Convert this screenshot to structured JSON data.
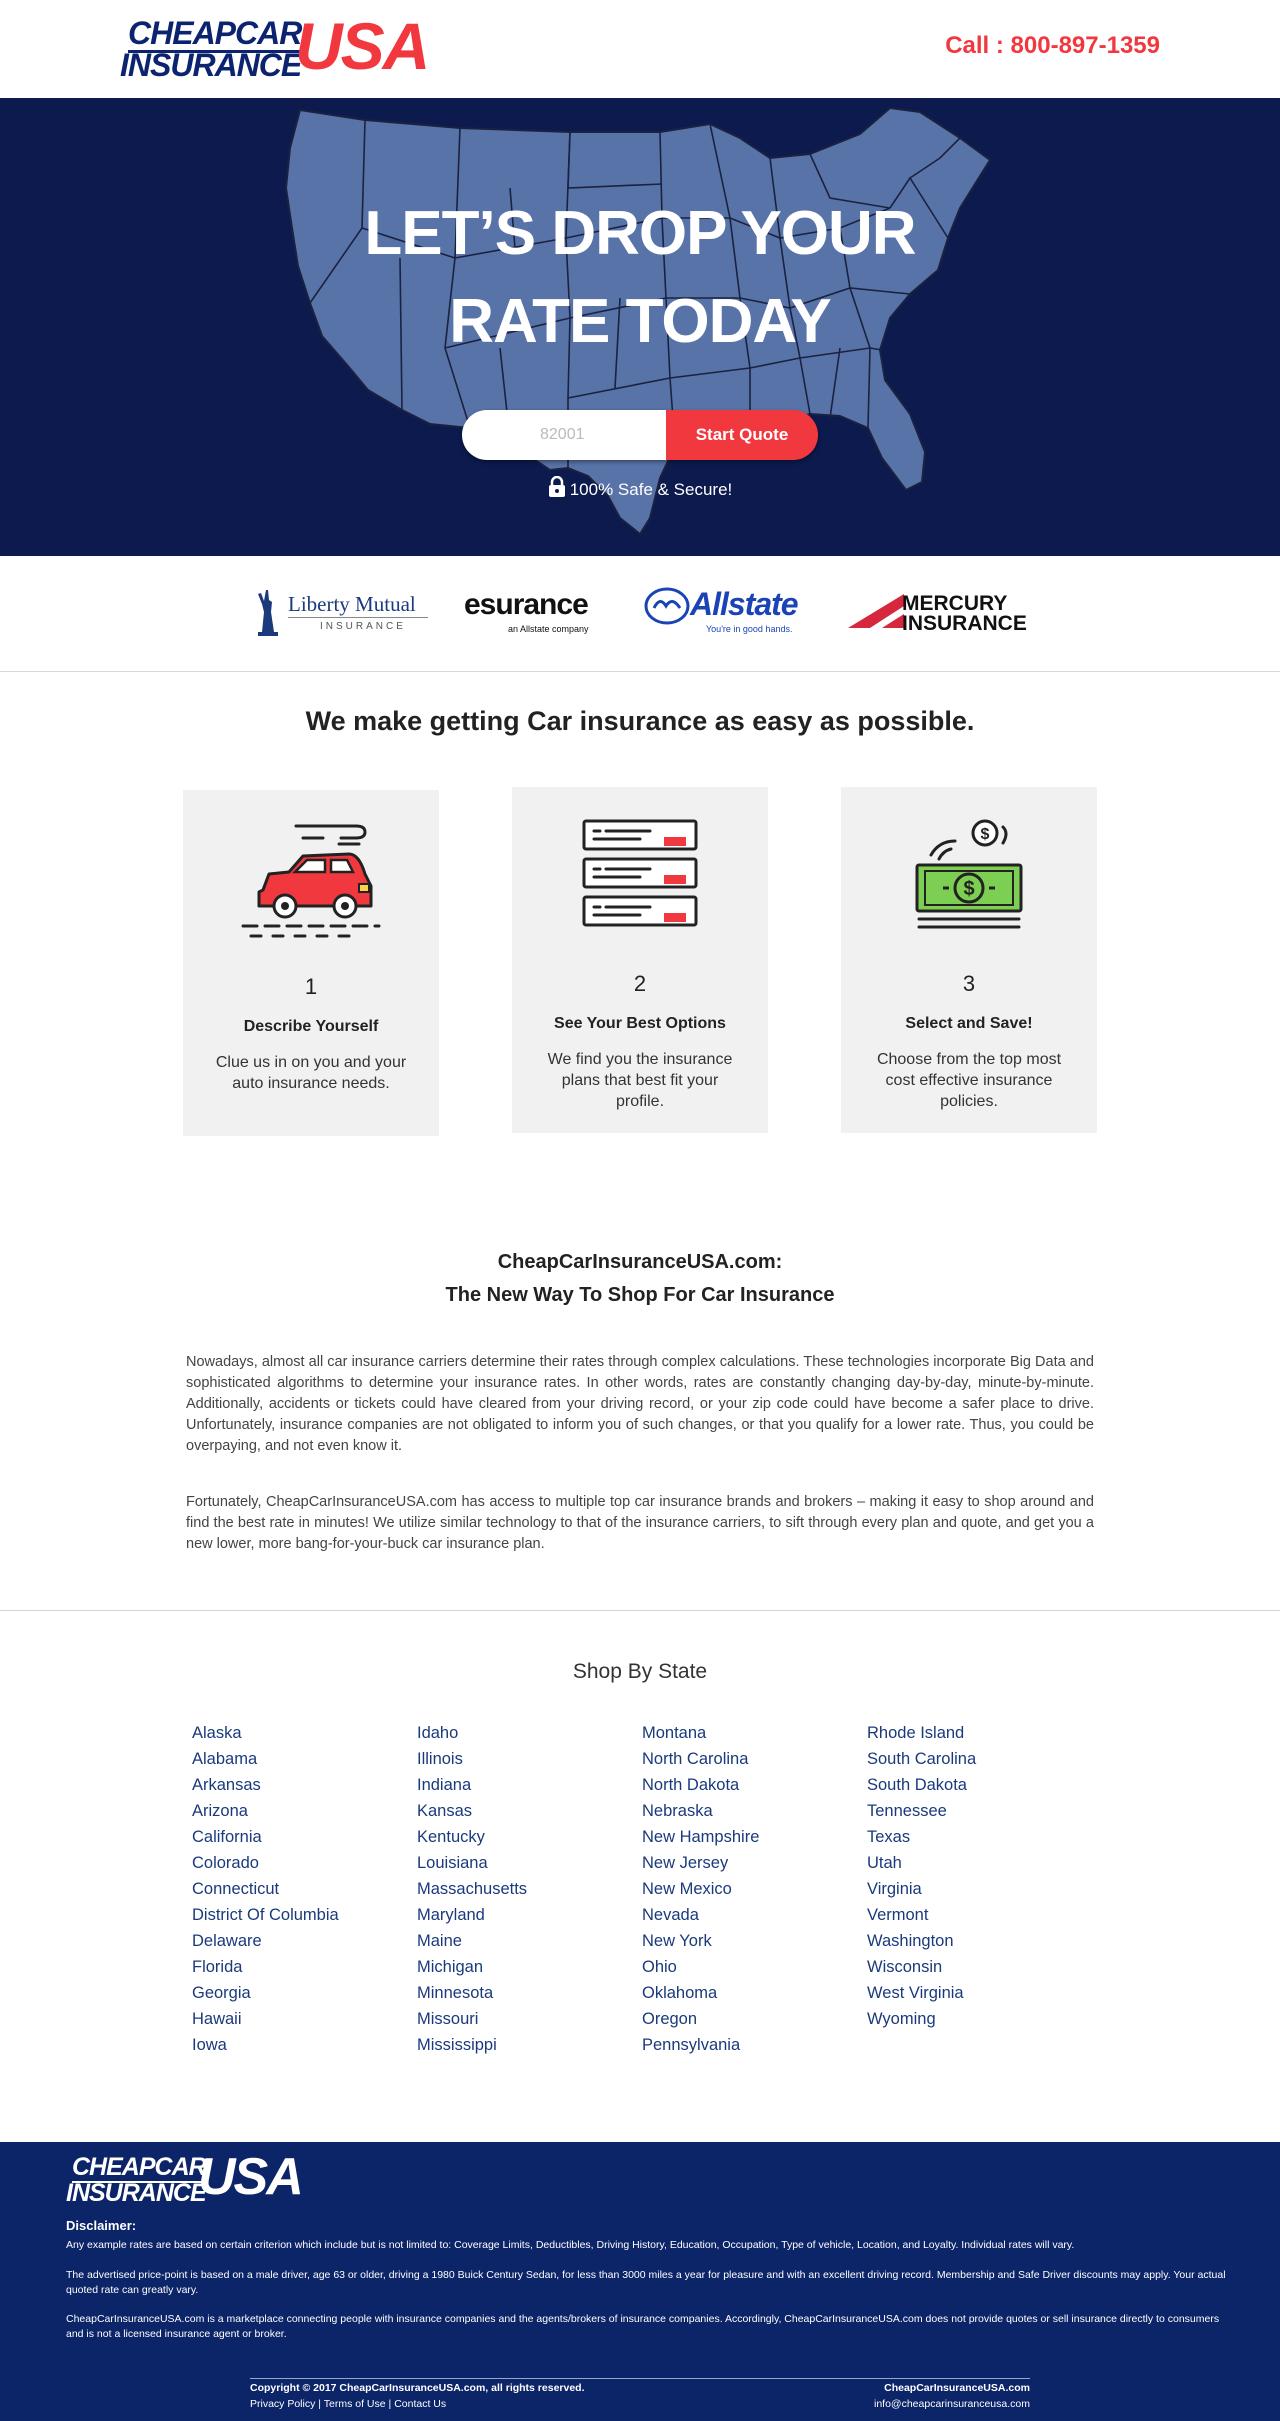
{
  "header": {
    "logo_line1": "CHEAPCAR",
    "logo_line2": "INSURANCE",
    "logo_usa": "USA",
    "phone": "Call : 800-897-1359"
  },
  "hero": {
    "title_line1": "LET’S DROP YOUR",
    "title_line2": "RATE TODAY",
    "zip_placeholder": "82001",
    "start_button": "Start Quote",
    "secure_text": "100% Safe & Secure!"
  },
  "partners": [
    {
      "name": "Liberty Mutual",
      "sub": "INSURANCE"
    },
    {
      "name": "esurance",
      "sub": "an Allstate company"
    },
    {
      "name": "Allstate",
      "sub": "You're in good hands."
    },
    {
      "name": "MERCURY",
      "sub": "INSURANCE"
    }
  ],
  "steps_section": {
    "title": "We make getting Car insurance as easy as possible.",
    "steps": [
      {
        "number": "1",
        "title": "Describe Yourself",
        "desc": "Clue us in on you and your auto insurance needs.",
        "icon": "car-icon"
      },
      {
        "number": "2",
        "title": "See Your Best Options",
        "desc": "We find you the insurance plans that best fit your profile.",
        "icon": "options-list-icon"
      },
      {
        "number": "3",
        "title": "Select and Save!",
        "desc": "Choose from the top most cost effective insurance policies.",
        "icon": "money-icon"
      }
    ]
  },
  "about": {
    "title_line1": "CheapCarInsuranceUSA.com:",
    "title_line2": "The New Way To Shop For Car Insurance",
    "p1": "Nowadays, almost all car insurance carriers determine their rates through complex calculations. These technologies incorporate Big Data and sophisticated algorithms to determine your insurance rates. In other words, rates are constantly changing day-by-day, minute-by-minute. Additionally, accidents or tickets could have cleared from your driving record, or your zip code could have become a safer place to drive. Unfortunately, insurance companies are not obligated to inform you of such changes, or that you qualify for a lower rate. Thus, you could be overpaying, and not even know it.",
    "p2": "Fortunately, CheapCarInsuranceUSA.com has access to multiple top car insurance brands and brokers – making it easy to shop around and find the best rate in minutes! We utilize similar technology to that of the insurance carriers, to sift through every plan and quote, and get you a new lower, more bang-for-your-buck car insurance plan."
  },
  "states": {
    "title": "Shop By State",
    "columns": [
      [
        "Alaska",
        "Alabama",
        "Arkansas",
        "Arizona",
        "California",
        "Colorado",
        "Connecticut",
        "District Of Columbia",
        "Delaware",
        "Florida",
        "Georgia",
        "Hawaii",
        "Iowa"
      ],
      [
        "Idaho",
        "Illinois",
        "Indiana",
        "Kansas",
        "Kentucky",
        "Louisiana",
        "Massachusetts",
        "Maryland",
        "Maine",
        "Michigan",
        "Minnesota",
        "Missouri",
        "Mississippi"
      ],
      [
        "Montana",
        "North Carolina",
        "North Dakota",
        "Nebraska",
        "New Hampshire",
        "New Jersey",
        "New Mexico",
        "Nevada",
        "New York",
        "Ohio",
        "Oklahoma",
        "Oregon",
        "Pennsylvania"
      ],
      [
        "Rhode Island",
        "South Carolina",
        "South Dakota",
        "Tennessee",
        "Texas",
        "Utah",
        "Virginia",
        "Vermont",
        "Washington",
        "Wisconsin",
        "West Virginia",
        "Wyoming"
      ]
    ]
  },
  "footer": {
    "logo_line1": "CHEAPCAR",
    "logo_line2": "INSURANCE",
    "logo_usa": "USA",
    "disclaimer_heading": "Disclaimer:",
    "disclaimer1": "Any example rates are based on certain criterion which include but is not limited to: Coverage Limits, Deductibles, Driving History, Education, Occupation, Type of vehicle, Location, and Loyalty. Individual rates will vary.",
    "disclaimer2": "The advertised price-point is based on a male driver, age 63 or older, driving a 1980 Buick Century Sedan, for less than 3000 miles a year for pleasure and with an excellent driving record. Membership and Safe Driver discounts may apply. Your actual quoted rate can greatly vary.",
    "disclaimer3": "CheapCarInsuranceUSA.com is a marketplace connecting people with insurance companies and the agents/brokers of insurance companies. Accordingly, CheapCarInsuranceUSA.com does not provide quotes or sell insurance directly to consumers and is not a licensed insurance agent or broker.",
    "copyright": "Copyright © 2017 CheapCarInsuranceUSA.com, all rights reserved.",
    "privacy": "Privacy Policy",
    "terms": "Terms of Use",
    "contact": "Contact Us",
    "site": "CheapCarInsuranceUSA.com",
    "email": "info@cheapcarinsuranceusa.com"
  },
  "colors": {
    "navy": "#0c2470",
    "hero_bg": "#0c1a4e",
    "map_fill": "#5873a8",
    "accent_red": "#f2383f",
    "card_bg": "#f1f1f1"
  }
}
